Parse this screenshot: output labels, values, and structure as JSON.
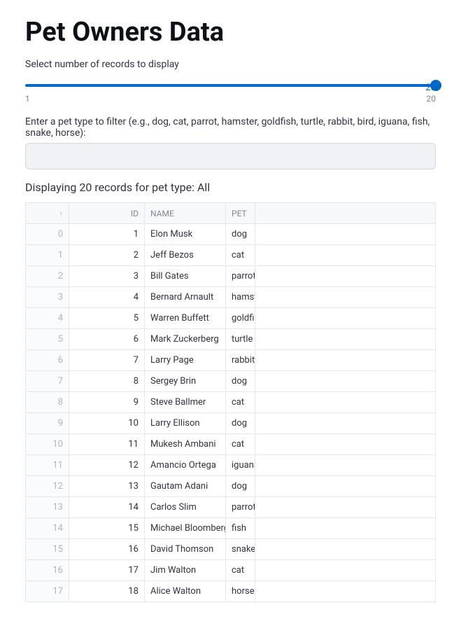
{
  "title": "Pet Owners Data",
  "slider": {
    "label": "Select number of records to display",
    "value": "20",
    "min": "1",
    "max": "20"
  },
  "filter": {
    "label": "Enter a pet type to filter (e.g., dog, cat, parrot, hamster, goldfish, turtle, rabbit, bird, iguana, fish, snake, horse):",
    "value": ""
  },
  "status": "Displaying 20 records for pet type: All",
  "table": {
    "headers": {
      "index_sort": "↑",
      "id": "ID",
      "name": "NAME",
      "pet": "PET"
    },
    "rows": [
      {
        "idx": "0",
        "id": "1",
        "name": "Elon Musk",
        "pet": "dog"
      },
      {
        "idx": "1",
        "id": "2",
        "name": "Jeff Bezos",
        "pet": "cat"
      },
      {
        "idx": "2",
        "id": "3",
        "name": "Bill Gates",
        "pet": "parrot"
      },
      {
        "idx": "3",
        "id": "4",
        "name": "Bernard Arnault",
        "pet": "hamster"
      },
      {
        "idx": "4",
        "id": "5",
        "name": "Warren Buffett",
        "pet": "goldfish"
      },
      {
        "idx": "5",
        "id": "6",
        "name": "Mark Zuckerberg",
        "pet": "turtle"
      },
      {
        "idx": "6",
        "id": "7",
        "name": "Larry Page",
        "pet": "rabbit"
      },
      {
        "idx": "7",
        "id": "8",
        "name": "Sergey Brin",
        "pet": "dog"
      },
      {
        "idx": "8",
        "id": "9",
        "name": "Steve Ballmer",
        "pet": "cat"
      },
      {
        "idx": "9",
        "id": "10",
        "name": "Larry Ellison",
        "pet": "dog"
      },
      {
        "idx": "10",
        "id": "11",
        "name": "Mukesh Ambani",
        "pet": "cat"
      },
      {
        "idx": "11",
        "id": "12",
        "name": "Amancio Ortega",
        "pet": "iguana"
      },
      {
        "idx": "12",
        "id": "13",
        "name": "Gautam Adani",
        "pet": "dog"
      },
      {
        "idx": "13",
        "id": "14",
        "name": "Carlos Slim",
        "pet": "parrot"
      },
      {
        "idx": "14",
        "id": "15",
        "name": "Michael Bloomberg",
        "pet": "fish"
      },
      {
        "idx": "15",
        "id": "16",
        "name": "David Thomson",
        "pet": "snake"
      },
      {
        "idx": "16",
        "id": "17",
        "name": "Jim Walton",
        "pet": "cat"
      },
      {
        "idx": "17",
        "id": "18",
        "name": "Alice Walton",
        "pet": "horse"
      }
    ]
  }
}
